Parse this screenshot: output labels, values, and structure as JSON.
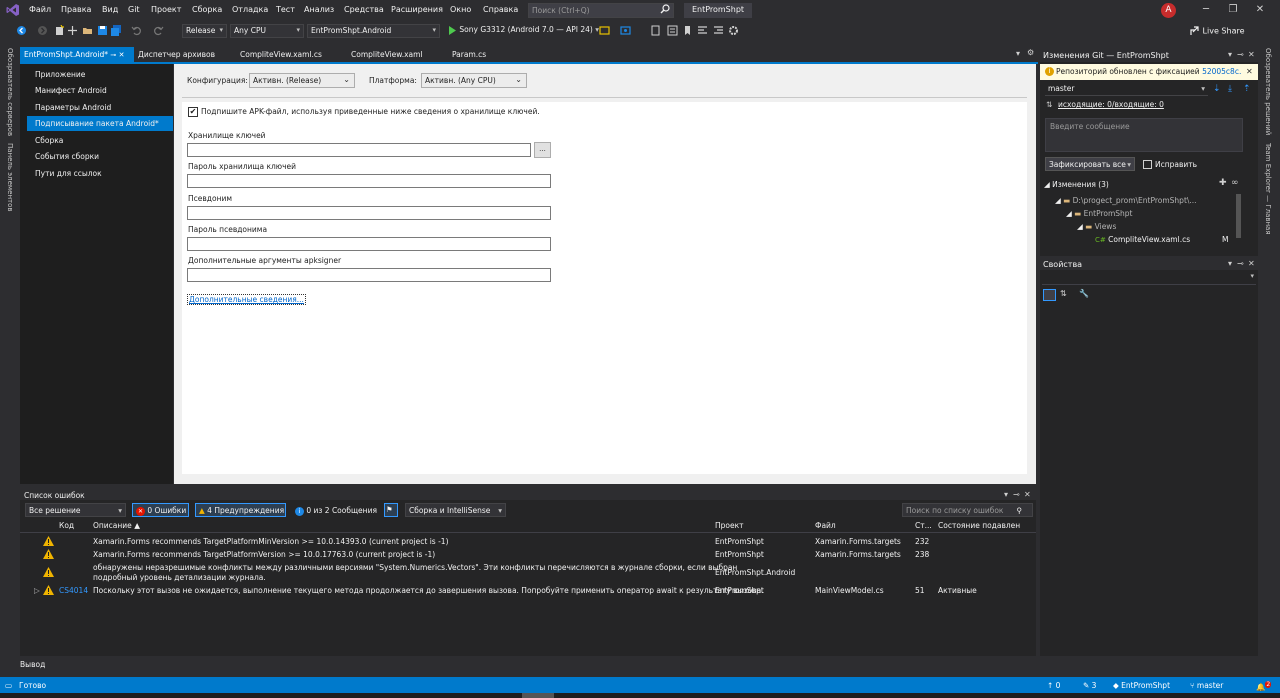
{
  "menu": {
    "items": [
      "Файл",
      "Правка",
      "Вид",
      "Git",
      "Проект",
      "Сборка",
      "Отладка",
      "Тест",
      "Анализ",
      "Средства",
      "Расширения",
      "Окно",
      "Справка"
    ],
    "search_placeholder": "Поиск (Ctrl+Q)",
    "project_title": "EntPromShpt",
    "avatar_letter": "A"
  },
  "toolbar": {
    "config": "Release",
    "platform": "Any CPU",
    "startup_project": "EntPromShpt.Android",
    "run_target": "Sony G3312 (Android 7.0 — API 24)",
    "live_share": "Live Share"
  },
  "side_strips": {
    "left_1": "Обозреватель серверов",
    "left_2": "Панель элементов",
    "right_1": "Обозреватель решений",
    "right_2": "Team Explorer — Главная"
  },
  "doc_tabs": [
    "EntPromShpt.Android*",
    "Диспетчер архивов",
    "CompliteView.xaml.cs",
    "CompliteView.xaml",
    "Param.cs"
  ],
  "nav": {
    "items": [
      "Приложение",
      "Манифест Android",
      "Параметры Android",
      "Подписывание пакета Android*",
      "Сборка",
      "События сборки",
      "Пути для ссылок"
    ],
    "selected_index": 3
  },
  "form": {
    "config_label": "Конфигурация:",
    "config_value": "Активн. (Release)",
    "platform_label": "Платформа:",
    "platform_value": "Активн. (Any CPU)",
    "sign_checkbox_label": "Подпишите APK-файл, используя приведенные ниже сведения о хранилище ключей.",
    "sign_checked": true,
    "keystore_label": "Хранилище ключей",
    "browse_label": "...",
    "keystore_password_label": "Пароль хранилища ключей",
    "alias_label": "Псевдоним",
    "alias_password_label": "Пароль псевдонима",
    "apksigner_label": "Дополнительные аргументы apksigner",
    "more_info_link": "Дополнительные сведения..."
  },
  "git": {
    "title": "Изменения Git — EntPromShpt",
    "info_text": "Репозиторий обновлен с фиксацией ",
    "info_commit": "52005c8c.",
    "branch": "master",
    "sync_text": "исходящие: 0/входящие: 0",
    "message_placeholder": "Введите сообщение",
    "commit_button": "Зафиксировать все",
    "amend_label": "Исправить",
    "changes_header": "Изменения (3)",
    "tree": [
      "D:\\progect_prom\\EntPromShpt\\...",
      "EntPromShpt",
      "Views",
      "CompliteView.xaml.cs"
    ],
    "file_status": "M"
  },
  "properties": {
    "title": "Свойства"
  },
  "errors": {
    "title": "Список ошибок",
    "scope": "Все решение",
    "errors_btn": "0 Ошибки",
    "warnings_btn": "4 Предупреждения",
    "messages_btn": "0 из 2 Сообщения",
    "build_filter": "Сборка и IntelliSense",
    "search_placeholder": "Поиск по списку ошибок",
    "columns": [
      "Код",
      "Описание",
      "Проект",
      "Файл",
      "Ст...",
      "Состояние подавлен"
    ],
    "rows": [
      {
        "code": "",
        "desc": "Xamarin.Forms recommends TargetPlatformMinVersion >= 10.0.14393.0 (current project is -1)",
        "desc2": "",
        "project": "EntPromShpt",
        "file": "Xamarin.Forms.targets",
        "line": "232",
        "state": ""
      },
      {
        "code": "",
        "desc": "Xamarin.Forms recommends TargetPlatformVersion >= 10.0.17763.0 (current project is -1)",
        "desc2": "",
        "project": "EntPromShpt",
        "file": "Xamarin.Forms.targets",
        "line": "238",
        "state": ""
      },
      {
        "code": "",
        "desc": "обнаружены неразрешимые конфликты между различными версиями \"System.Numerics.Vectors\". Эти конфликты перечисляются в журнале сборки, если выбран",
        "desc2": "подробный уровень детализации журнала.",
        "project": "EntPromShpt.Android",
        "file": "",
        "line": "",
        "state": ""
      },
      {
        "code": "CS4014",
        "desc": "Поскольку этот вызов не ожидается, выполнение текущего метода продолжается до завершения вызова. Попробуйте применить оператор await к результату вызова.",
        "desc2": "",
        "project": "EntPromShpt",
        "file": "MainViewModel.cs",
        "line": "51",
        "state": "Активные"
      }
    ]
  },
  "output_label": "Вывод",
  "status": {
    "ready": "Готово",
    "up": "0",
    "pencil": "3",
    "repo": "EntPromShpt",
    "branch": "master",
    "bell": "2"
  }
}
